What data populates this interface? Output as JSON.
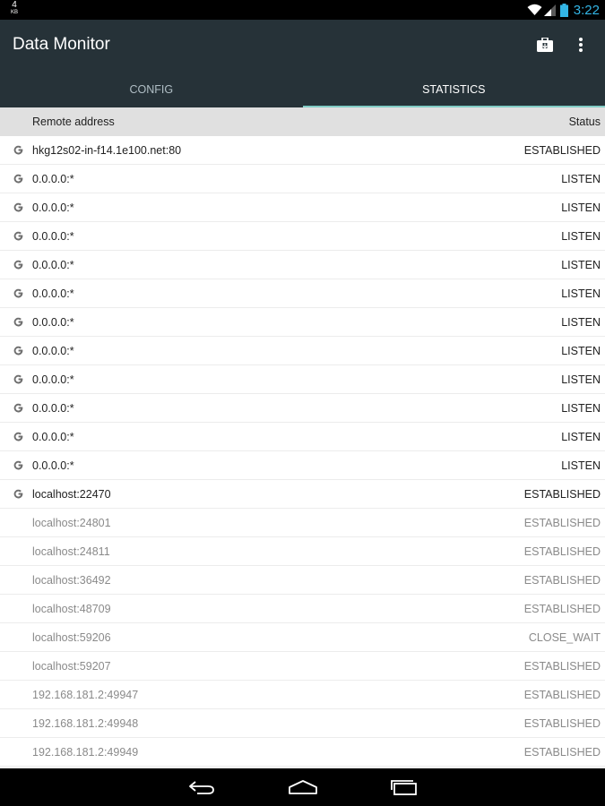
{
  "status_bar": {
    "net_speed_value": "4",
    "net_speed_unit": "KB",
    "time": "3:22",
    "icons": [
      "wifi-icon",
      "cell-signal-icon",
      "battery-icon"
    ]
  },
  "app_bar": {
    "title": "Data Monitor",
    "actions": [
      "briefcase-icon",
      "overflow-menu-icon"
    ]
  },
  "tabs": [
    {
      "label": "CONFIG",
      "active": false
    },
    {
      "label": "STATISTICS",
      "active": true
    }
  ],
  "table": {
    "col_address": "Remote address",
    "col_status": "Status",
    "rows": [
      {
        "address": "hkg12s02-in-f14.1e100.net:80",
        "status": "ESTABLISHED",
        "icon": "google-icon"
      },
      {
        "address": "0.0.0.0:*",
        "status": "LISTEN",
        "icon": "google-icon"
      },
      {
        "address": "0.0.0.0:*",
        "status": "LISTEN",
        "icon": "google-icon"
      },
      {
        "address": "0.0.0.0:*",
        "status": "LISTEN",
        "icon": "google-icon"
      },
      {
        "address": "0.0.0.0:*",
        "status": "LISTEN",
        "icon": "google-icon"
      },
      {
        "address": "0.0.0.0:*",
        "status": "LISTEN",
        "icon": "google-icon"
      },
      {
        "address": "0.0.0.0:*",
        "status": "LISTEN",
        "icon": "google-icon"
      },
      {
        "address": "0.0.0.0:*",
        "status": "LISTEN",
        "icon": "google-icon"
      },
      {
        "address": "0.0.0.0:*",
        "status": "LISTEN",
        "icon": "google-icon"
      },
      {
        "address": "0.0.0.0:*",
        "status": "LISTEN",
        "icon": "google-icon"
      },
      {
        "address": "0.0.0.0:*",
        "status": "LISTEN",
        "icon": "google-icon"
      },
      {
        "address": "0.0.0.0:*",
        "status": "LISTEN",
        "icon": "google-icon"
      },
      {
        "address": "localhost:22470",
        "status": "ESTABLISHED",
        "icon": "google-icon"
      },
      {
        "address": "localhost:24801",
        "status": "ESTABLISHED",
        "icon": ""
      },
      {
        "address": "localhost:24811",
        "status": "ESTABLISHED",
        "icon": ""
      },
      {
        "address": "localhost:36492",
        "status": "ESTABLISHED",
        "icon": ""
      },
      {
        "address": "localhost:48709",
        "status": "ESTABLISHED",
        "icon": ""
      },
      {
        "address": "localhost:59206",
        "status": "CLOSE_WAIT",
        "icon": ""
      },
      {
        "address": "localhost:59207",
        "status": "ESTABLISHED",
        "icon": ""
      },
      {
        "address": "192.168.181.2:49947",
        "status": "ESTABLISHED",
        "icon": ""
      },
      {
        "address": "192.168.181.2:49948",
        "status": "ESTABLISHED",
        "icon": ""
      },
      {
        "address": "192.168.181.2:49949",
        "status": "ESTABLISHED",
        "icon": ""
      }
    ]
  },
  "nav_bar": {
    "buttons": [
      "back-icon",
      "home-icon",
      "recents-icon"
    ]
  },
  "colors": {
    "app_bar": "#263238",
    "tab_indicator": "#80cbc4",
    "clock": "#33b5e5",
    "table_header": "#e0e0e0",
    "dim_text": "#8a8a8a"
  }
}
